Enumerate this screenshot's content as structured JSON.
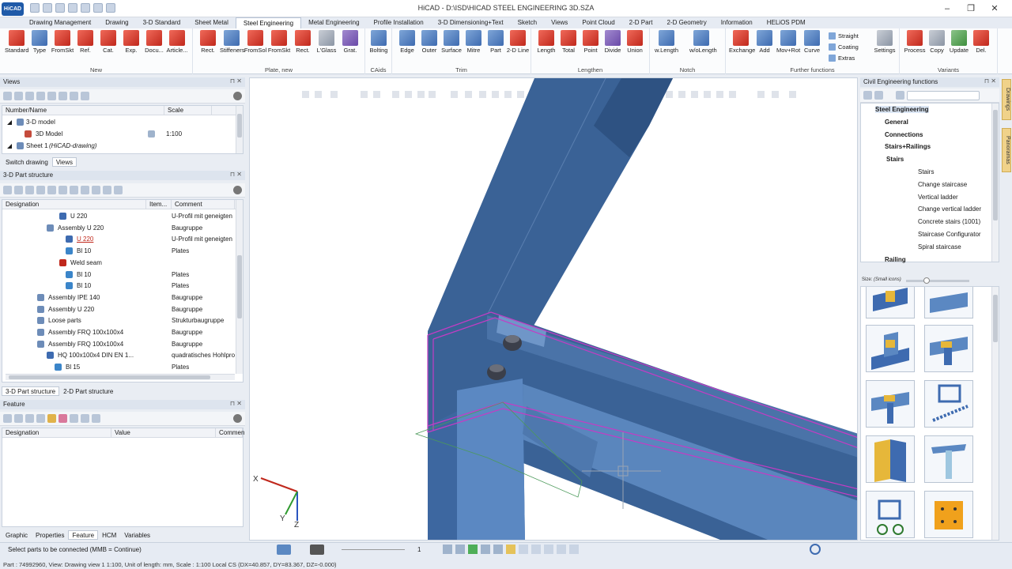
{
  "window": {
    "title": "HiCAD - D:\\ISD\\HICAD STEEL ENGINEERING 3D.SZA",
    "logo": "HiCAD"
  },
  "menu": [
    "Drawing Management",
    "Drawing",
    "3-D Standard",
    "Sheet Metal",
    "Steel Engineering",
    "Metal Engineering",
    "Profile Installation",
    "3-D Dimensioning+Text",
    "Sketch",
    "Views",
    "Point Cloud",
    "2-D Part",
    "2-D Geometry",
    "Information",
    "HELiOS PDM"
  ],
  "menu_active": "Steel Engineering",
  "ribbon": {
    "groups": {
      "new": "New",
      "plate_new": "Plate, new",
      "caids": "CAids",
      "trim": "Trim",
      "lengthen": "Lengthen",
      "notch": "Notch",
      "further": "Further functions",
      "variants": "Variants"
    },
    "new": [
      "Standard",
      "Type",
      "FromSkt",
      "Ref.",
      "Cat.",
      "Exp.",
      "Docu...",
      "Article..."
    ],
    "plate_new": [
      "Rect.",
      "Stiffeners",
      "FromSol",
      "FromSkt",
      "Rect.",
      "L'Glass",
      "Grat."
    ],
    "caids": [
      "Bolting"
    ],
    "trim": [
      "Edge",
      "Outer",
      "Surface",
      "Mitre",
      "Part",
      "2-D Line"
    ],
    "lengthen": [
      "Length",
      "Total",
      "Point",
      "Divide",
      "Union"
    ],
    "notch": [
      "w.Length",
      "w/oLength"
    ],
    "further": [
      "Exchange",
      "Add",
      "Mov+Rot",
      "Curve"
    ],
    "further_small": [
      "Straight",
      "Coating",
      "Extras"
    ],
    "settings": "Settings",
    "variants": [
      "Process",
      "Copy",
      "Update",
      "Del."
    ]
  },
  "views_panel": {
    "title": "Views",
    "headers": [
      "Number/Name",
      "Scale"
    ],
    "rows": [
      {
        "name": "3-D model",
        "scale": ""
      },
      {
        "name": "3D Model",
        "scale": "1:100"
      },
      {
        "name": "Sheet 1",
        "note": "(HiCAD-drawing)",
        "scale": ""
      }
    ],
    "tabs": [
      "Switch drawing",
      "Views"
    ]
  },
  "part_structure": {
    "title": "3-D Part structure",
    "headers": [
      "Designation",
      "Item...",
      "Comment"
    ],
    "rows": [
      {
        "name": "U 220",
        "comment": "U-Profil mit geneigten"
      },
      {
        "name": "Assembly U 220",
        "comment": "Baugruppe"
      },
      {
        "name": "U 220",
        "comment": "U-Profil mit geneigten"
      },
      {
        "name": "Bl 10",
        "comment": "Plates"
      },
      {
        "name": "Weld seam",
        "comment": ""
      },
      {
        "name": "Bl 10",
        "comment": "Plates"
      },
      {
        "name": "Bl 10",
        "comment": "Plates"
      },
      {
        "name": "Assembly IPE 140",
        "comment": "Baugruppe"
      },
      {
        "name": "Assembly U 220",
        "comment": "Baugruppe"
      },
      {
        "name": "Loose parts",
        "comment": "Strukturbaugruppe"
      },
      {
        "name": "Assembly FRQ 100x100x4",
        "comment": "Baugruppe"
      },
      {
        "name": "Assembly FRQ 100x100x4",
        "comment": "Baugruppe"
      },
      {
        "name": "HQ 100x100x4 DIN EN 1...",
        "comment": "quadratisches Hohlpro"
      },
      {
        "name": "Bl 15",
        "comment": "Plates"
      }
    ],
    "tabs": [
      "3-D Part structure",
      "2-D Part structure"
    ]
  },
  "feature_panel": {
    "title": "Feature",
    "headers": [
      "Designation",
      "Value",
      "Commen"
    ],
    "tabs": [
      "Graphic",
      "Properties",
      "Feature",
      "HCM",
      "Variables"
    ]
  },
  "civil_panel": {
    "title": "Civil Engineering functions",
    "tree": [
      {
        "label": "Steel Engineering",
        "level": 0
      },
      {
        "label": "General",
        "level": 1
      },
      {
        "label": "Connections",
        "level": 1
      },
      {
        "label": "Stairs+Railings",
        "level": 1
      },
      {
        "label": "Stairs",
        "level": 2
      },
      {
        "label": "Stairs",
        "level": 3
      },
      {
        "label": "Change staircase",
        "level": 3
      },
      {
        "label": "Vertical ladder",
        "level": 3
      },
      {
        "label": "Change vertical ladder",
        "level": 3
      },
      {
        "label": "Concrete stairs (1001)",
        "level": 3
      },
      {
        "label": "Staircase Configurator",
        "level": 3
      },
      {
        "label": "Spiral staircase",
        "level": 3
      },
      {
        "label": "Railing",
        "level": 1
      }
    ],
    "size_label": "Size:",
    "size_value": "(Small icons)"
  },
  "side_tabs": [
    "Drawings",
    "Panoramas"
  ],
  "status": {
    "prompt": "Select parts to be connected (MMB = Continue)",
    "line": "Part : 74992960, View: Drawing view 1 1:100, Unit of length: mm, Scale : 1:100  Local CS  (DX=40.857, DY=83.367, DZ=-0.000)",
    "layer_value": "1"
  },
  "axes": {
    "x": "X",
    "y": "Y",
    "z": "Z"
  },
  "colors": {
    "accent": "#1f5aa8",
    "beam": "#3a6296",
    "highlight": "#c43cc4",
    "ribbon_bg": "#fbfcfd"
  }
}
